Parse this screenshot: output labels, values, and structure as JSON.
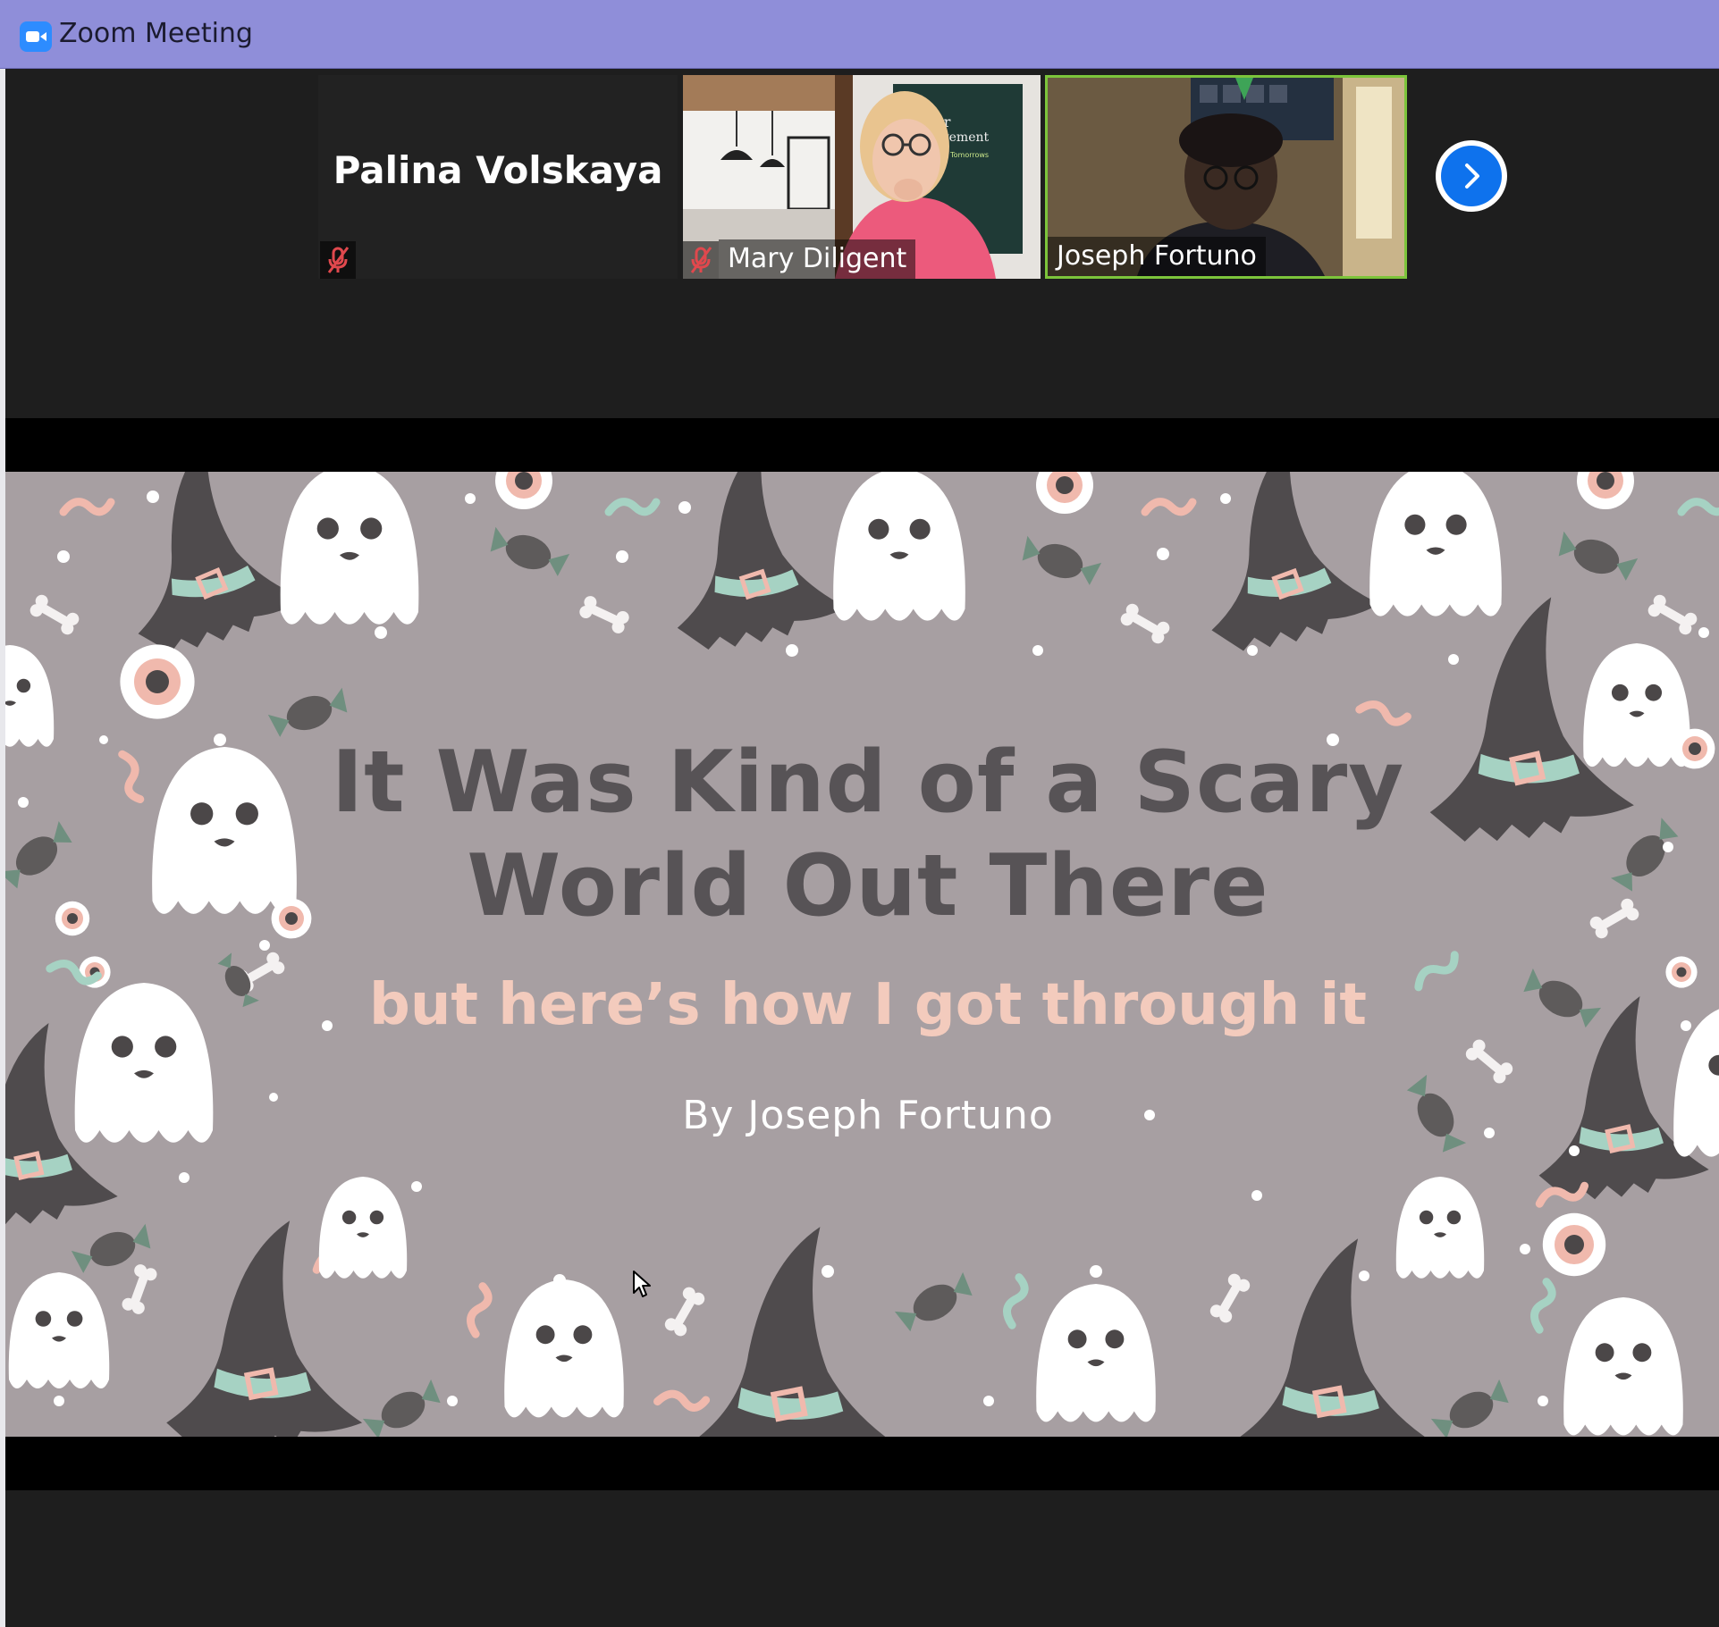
{
  "window": {
    "title": "Zoom Meeting"
  },
  "participants": [
    {
      "name": "Palina Volskaya",
      "muted": true,
      "video": false
    },
    {
      "name": "Mary Diligent",
      "muted": true,
      "video": true,
      "background_sign": [
        "Junior",
        "Achievement",
        "Inspiring Tomorrows"
      ]
    },
    {
      "name": "Joseph Fortuno",
      "muted": false,
      "video": true,
      "active_speaker": true
    }
  ],
  "gallery": {
    "next_page_icon": "chevron-right-icon"
  },
  "shared_slide": {
    "title_line1": "It Was Kind of a Scary",
    "title_line2": "World Out There",
    "subtitle": "but here’s how I got through it",
    "author": "By Joseph Fortuno",
    "colors": {
      "background": "#a79fa2",
      "title": "#575356",
      "subtitle": "#f3cbbd",
      "author": "#ffffff"
    }
  },
  "colors": {
    "titlebar": "#8f8ed9",
    "accent": "#0e72ed",
    "active_border": "#7cc43b",
    "mute": "#e0484d"
  }
}
